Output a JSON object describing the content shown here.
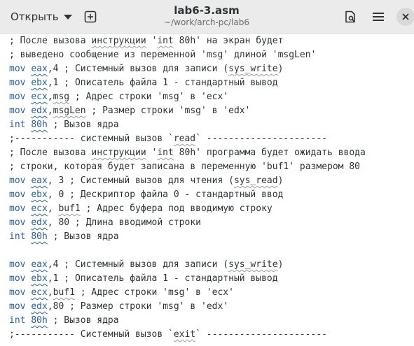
{
  "header": {
    "open_label": "Открыть",
    "title": "lab6-3.asm",
    "subtitle": "~/work/arch-pc/lab6",
    "icons": [
      "caret-down-icon",
      "new-tab-icon",
      "save-icon",
      "menu-icon",
      "close-icon"
    ]
  },
  "editor": {
    "lines": [
      "; После вызова инструкции 'int 80h' на экран будет",
      "; выведено сообщение из переменной 'msg' длиной 'msgLen'",
      "mov eax,4 ; Системный вызов для записи (sys_write)",
      "mov ebx,1 ; Описатель файла 1 - стандартный вывод",
      "mov ecx,msg ; Адрес строки 'msg' в 'ecx'",
      "mov edx,msgLen ; Размер строки 'msg' в 'edx'",
      "int 80h ; Вызов ядра",
      ";----------- системный вызов `read` ----------------------",
      "; После вызова инструкции 'int 80h' программа будет ожидать ввода",
      "; строки, которая будет записана в переменную 'buf1' размером 80",
      "mov eax, 3 ; Системный вызов для чтения (sys_read)",
      "mov ebx, 0 ; Дескриптор файла 0 - стандартный ввод",
      "mov ecx, buf1 ; Адрес буфера под вводимую строку",
      "mov edx, 80 ; Длина вводимой строки",
      "int 80h ; Вызов ядра",
      "",
      "mov eax,4 ; Системный вызов для записи (sys_write)",
      "mov ebx,1 ; Описатель файла 1 - стандартный вывод",
      "mov ecx,buf1 ; Адрес строки 'msg' в 'ecx'",
      "mov edx,80 ; Размер строки 'msg' в 'edx'",
      "int 80h ; Вызов ядра",
      ";----------- Системный вызов `exit` ----------------------"
    ]
  },
  "colors": {
    "keyword": "#2a6099",
    "text": "#2e3436",
    "header_bg": "#ebebeb"
  }
}
